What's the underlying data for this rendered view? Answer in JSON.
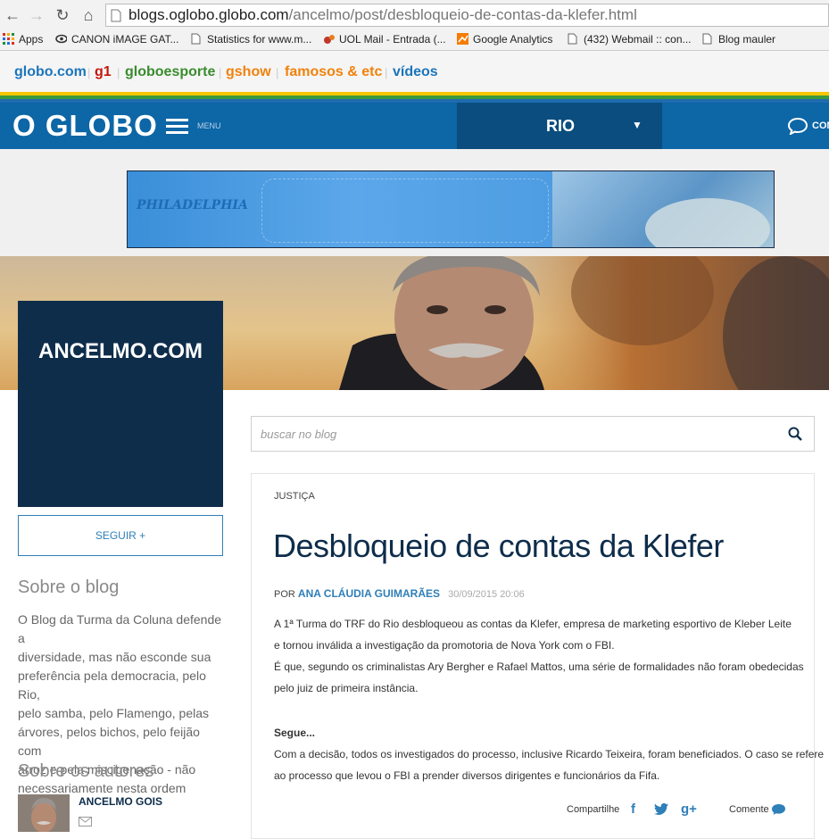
{
  "browser": {
    "url_host": "blogs.oglobo.globo.com",
    "url_path": "/ancelmo/post/desbloqueio-de-contas-da-klefer.html",
    "bookmarks": [
      {
        "label": "Apps",
        "icon": "apps-grid-icon"
      },
      {
        "label": "CANON iMAGE GAT...",
        "icon": "canon-icon"
      },
      {
        "label": "Statistics for www.m...",
        "icon": "page-icon"
      },
      {
        "label": "UOL Mail - Entrada (...",
        "icon": "uol-icon"
      },
      {
        "label": "Google Analytics",
        "icon": "analytics-icon"
      },
      {
        "label": "(432) Webmail :: con...",
        "icon": "page-icon"
      },
      {
        "label": "Blog mauler",
        "icon": "page-icon"
      }
    ]
  },
  "globo_links": [
    {
      "label": "globo.com",
      "color": "#1b75bb"
    },
    {
      "label": "g1",
      "color": "#c4170c"
    },
    {
      "label": "globoesporte",
      "color": "#3a8c2e"
    },
    {
      "label": "gshow",
      "color": "#f0820b"
    },
    {
      "label": "famosos & etc",
      "color": "#f0820b"
    },
    {
      "label": "vídeos",
      "color": "#1b75bb"
    }
  ],
  "header": {
    "logo": "O GLOBO",
    "menu_label": "MENU",
    "section": "RIO",
    "comment_label": "COM"
  },
  "ad": {
    "brand": "PHILADELPHIA"
  },
  "blog": {
    "title": "ANCELMO.COM",
    "follow_label": "SEGUIR +",
    "about_heading": "Sobre o blog",
    "about_lines": [
      "O Blog da Turma da Coluna defende a",
      "diversidade, mas não esconde sua",
      "preferência pela democracia, pelo Rio,",
      "pelo samba, pelo Flamengo, pelas",
      "árvores, pelos bichos, pelo feijão com",
      "arroz e pela miscigenação - não",
      "necessariamente nesta ordem"
    ],
    "authors_heading": "Sobre os autores",
    "author_name": "ANCELMO GOIS"
  },
  "search": {
    "placeholder": "buscar no blog"
  },
  "article": {
    "category": "JUSTIÇA",
    "title": "Desbloqueio de contas da Klefer",
    "by": "POR",
    "author": "ANA CLÁUDIA GUIMARÃES",
    "date": "30/09/2015 20:06",
    "body_lines": [
      "A 1ª Turma do TRF do Rio desbloqueou as  contas da Klefer,  empresa de marketing esportivo de Kleber Leite",
      "e  tornou inválida a investigação da promotoria de Nova York com o FBI.",
      "É que, segundo os criminalistas Ary Bergher e Rafael Mattos, uma série de formalidades não foram obedecidas",
      "pelo juiz de primeira instância."
    ],
    "segue": "Segue...",
    "body2_lines": [
      "Com a decisão, todos os investigados do processo, inclusive Ricardo Teixeira, foram beneficiados.  O caso se refere",
      "ao  processo que levou o FBI a prender diversos dirigentes e funcionários da Fifa."
    ],
    "share_label": "Compartilhe",
    "comment_label": "Comente"
  },
  "colors": {
    "header_blue": "#0d66a6",
    "section_dark": "#0a4d7e",
    "blog_navy": "#0e2d4b",
    "accent_blue": "#2f7fb8"
  }
}
